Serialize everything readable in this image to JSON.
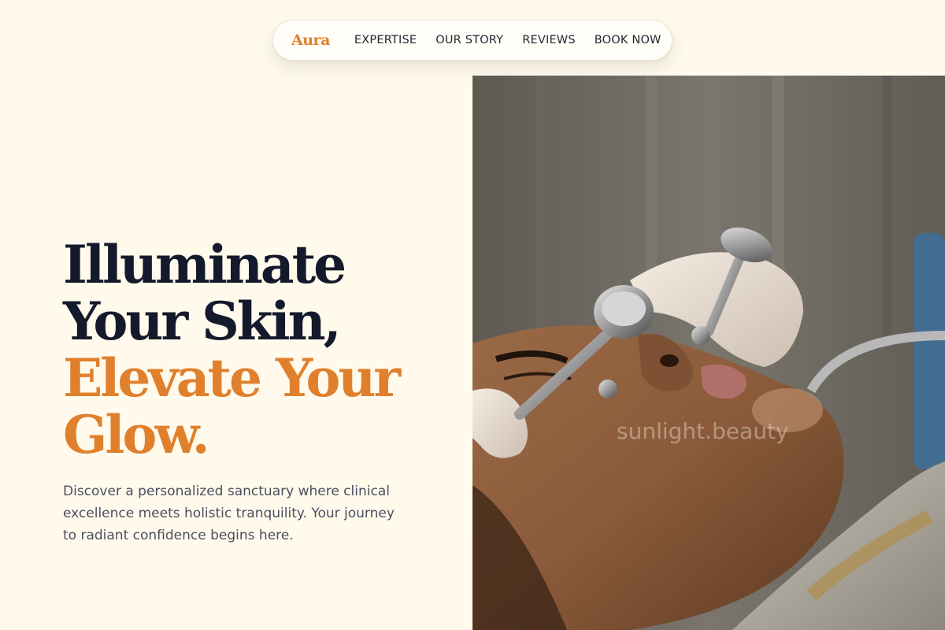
{
  "nav": {
    "logo": "Aura",
    "links": [
      "EXPERTISE",
      "OUR STORY",
      "REVIEWS",
      "BOOK NOW"
    ]
  },
  "hero": {
    "title_line_1": "Illuminate",
    "title_line_2": "Your Skin,",
    "title_line_3": "Elevate Your",
    "title_line_4": "Glow.",
    "description": "Discover a personalized sanctuary where clinical excellence meets holistic tranquility. Your journey to radiant confidence begins here."
  },
  "photo": {
    "watermark": "sunlight.beauty"
  },
  "colors": {
    "background": "#fffaec",
    "accent": "#e0802c",
    "heading": "#141a2b"
  }
}
